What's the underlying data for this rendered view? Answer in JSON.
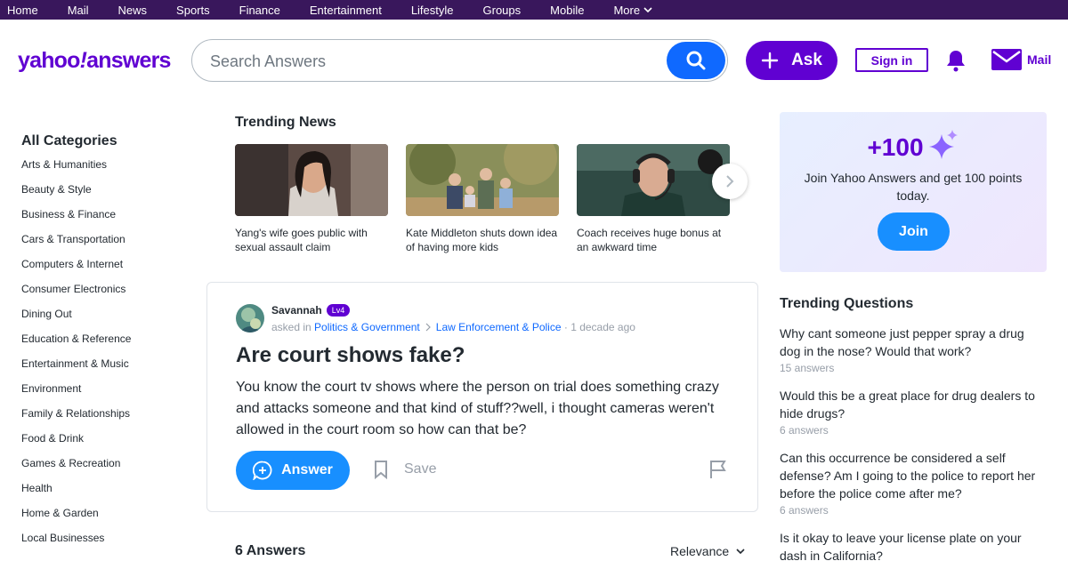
{
  "topnav": {
    "items": [
      "Home",
      "Mail",
      "News",
      "Sports",
      "Finance",
      "Entertainment",
      "Lifestyle",
      "Groups",
      "Mobile"
    ],
    "more_label": "More"
  },
  "header": {
    "logo_left": "yahoo",
    "logo_bang": "!",
    "logo_right": "answers",
    "search_placeholder": "Search Answers",
    "ask_label": "Ask",
    "signin_label": "Sign in",
    "mail_label": "Mail"
  },
  "categories": {
    "title": "All Categories",
    "items": [
      "Arts & Humanities",
      "Beauty & Style",
      "Business & Finance",
      "Cars & Transportation",
      "Computers & Internet",
      "Consumer Electronics",
      "Dining Out",
      "Education & Reference",
      "Entertainment & Music",
      "Environment",
      "Family & Relationships",
      "Food & Drink",
      "Games & Recreation",
      "Health",
      "Home & Garden",
      "Local Businesses"
    ]
  },
  "trending_news": {
    "title": "Trending News",
    "items": [
      {
        "caption": "Yang's wife goes public with sexual assault claim"
      },
      {
        "caption": "Kate Middleton shuts down idea of having more kids"
      },
      {
        "caption": "Coach receives huge bonus at an awkward time"
      }
    ]
  },
  "question": {
    "user": "Savannah",
    "level": "Lv4",
    "asked_in": "asked in",
    "category": "Politics & Government",
    "subcategory": "Law Enforcement & Police",
    "time": "· 1 decade ago",
    "title": "Are court shows fake?",
    "body": "You know the court tv shows where the person on trial does something crazy and attacks someone and that kind of stuff??well, i thought cameras weren't allowed in the court room so how can that be?",
    "answer_label": "Answer",
    "save_label": "Save"
  },
  "answers": {
    "count_label": "6 Answers",
    "sort_label": "Relevance"
  },
  "promo": {
    "points": "+100",
    "text": "Join Yahoo Answers and get 100 points today.",
    "join_label": "Join"
  },
  "trending_questions": {
    "title": "Trending Questions",
    "items": [
      {
        "q": "Why cant someone just pepper spray a drug dog in the nose? Would that work?",
        "n": "15 answers"
      },
      {
        "q": "Would this be a great place for drug dealers to hide drugs?",
        "n": "6 answers"
      },
      {
        "q": "Can this occurrence be considered a self defense? Am I going to the police to report her before the police come after me?",
        "n": "6 answers"
      },
      {
        "q": "Is it okay to leave your license plate on your dash in California?",
        "n": ""
      }
    ]
  },
  "colors": {
    "nav_bg": "#39175c",
    "brand_purple": "#6001d2",
    "action_blue": "#188fff",
    "search_blue": "#0f69ff"
  }
}
